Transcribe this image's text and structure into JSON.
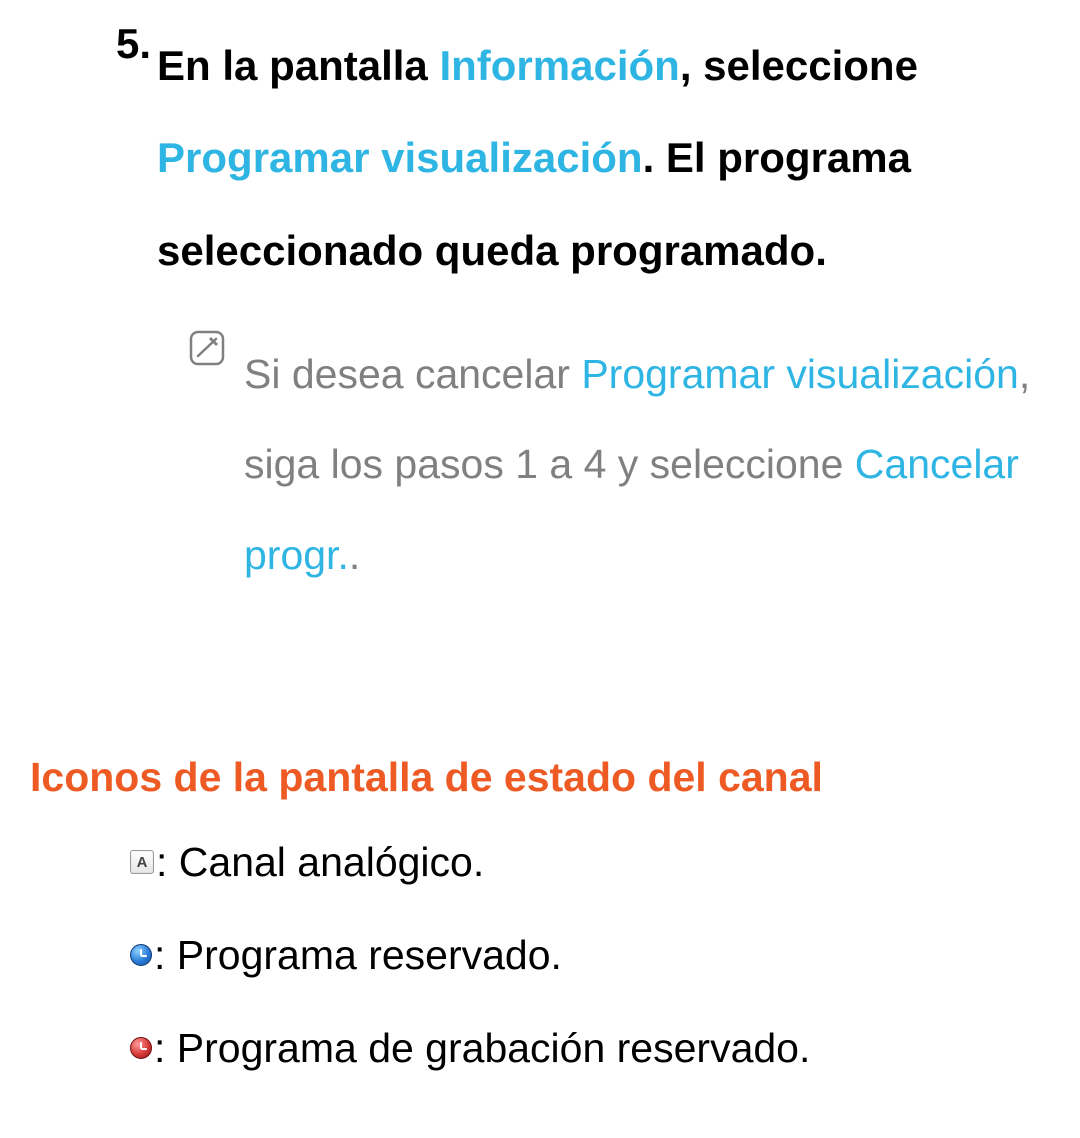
{
  "step": {
    "number": "5.",
    "seg1": "En la pantalla ",
    "hl1": "Información",
    "seg2": ", seleccione ",
    "hl2": "Programar visualización",
    "seg3": ". El programa seleccionado queda programado."
  },
  "note": {
    "seg1": "Si desea cancelar ",
    "hl1": "Programar visualización",
    "seg2": ", siga los pasos 1 a 4 y seleccione ",
    "hl2": "Cancelar progr.",
    "seg3": "."
  },
  "section_title": "Iconos de la pantalla de estado del canal",
  "icons": {
    "a_letter": "A",
    "analog_label": ": Canal analógico.",
    "reserved_label": ": Programa reservado.",
    "recording_label": ": Programa de grabación reservado."
  }
}
